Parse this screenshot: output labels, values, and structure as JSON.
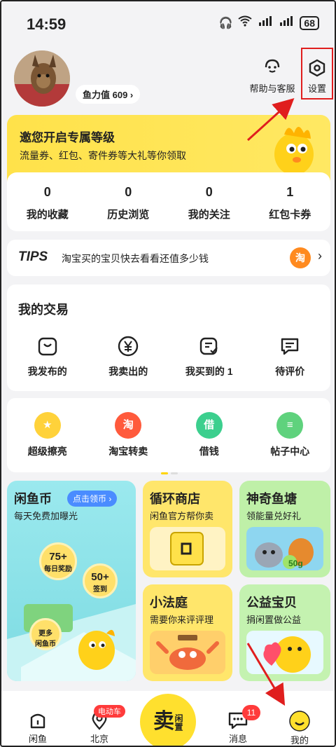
{
  "status": {
    "time": "14:59",
    "battery": "68"
  },
  "profile": {
    "score": "鱼力值 609 ›"
  },
  "header": {
    "help": "帮助与客服",
    "settings": "设置"
  },
  "banner": {
    "title": "邀您开启专属等级",
    "subtitle": "流量券、红包、寄件券等大礼等你领取"
  },
  "stats": [
    {
      "value": "0",
      "label": "我的收藏"
    },
    {
      "value": "0",
      "label": "历史浏览"
    },
    {
      "value": "0",
      "label": "我的关注"
    },
    {
      "value": "1",
      "label": "红包卡券"
    }
  ],
  "tips": {
    "tag": "TIPS",
    "text": "淘宝买的宝贝快去看看还值多少钱",
    "badge": "淘"
  },
  "trade": {
    "title": "我的交易",
    "items": [
      "我发布的",
      "我卖出的",
      "我买到的 1",
      "待评价"
    ]
  },
  "services": {
    "items": [
      {
        "label": "超级擦亮",
        "glyph": "★",
        "color": "#ffd23a"
      },
      {
        "label": "淘宝转卖",
        "glyph": "淘",
        "color": "#ff5a3c"
      },
      {
        "label": "借钱",
        "glyph": "借",
        "color": "#3ccf8e"
      },
      {
        "label": "帖子中心",
        "glyph": "≡",
        "color": "#5fd27d"
      }
    ]
  },
  "cards": {
    "coins": {
      "title": "闲鱼币",
      "pill": "点击领币 ›",
      "subtitle": "每天免费加曝光",
      "b1_top": "75+",
      "b1_bottom": "每日奖励",
      "b2_top": "50+",
      "b2_bottom": "签到",
      "b3_top": "更多",
      "b3_bottom": "闲鱼币"
    },
    "shop": {
      "title": "循环商店",
      "subtitle": "闲鱼官方帮你卖"
    },
    "pond": {
      "title": "神奇鱼塘",
      "subtitle": "领能量兑好礼",
      "amount": "50g"
    },
    "court": {
      "title": "小法庭",
      "subtitle": "需要你来评评理"
    },
    "charity": {
      "title": "公益宝贝",
      "subtitle": "捐闲置做公益"
    }
  },
  "tabbar": {
    "home": "闲鱼",
    "city": "北京",
    "city_chip": "电动车",
    "sell": "卖",
    "sell_sub": "闲置",
    "messages": "消息",
    "messages_count": "11",
    "mine": "我的"
  }
}
